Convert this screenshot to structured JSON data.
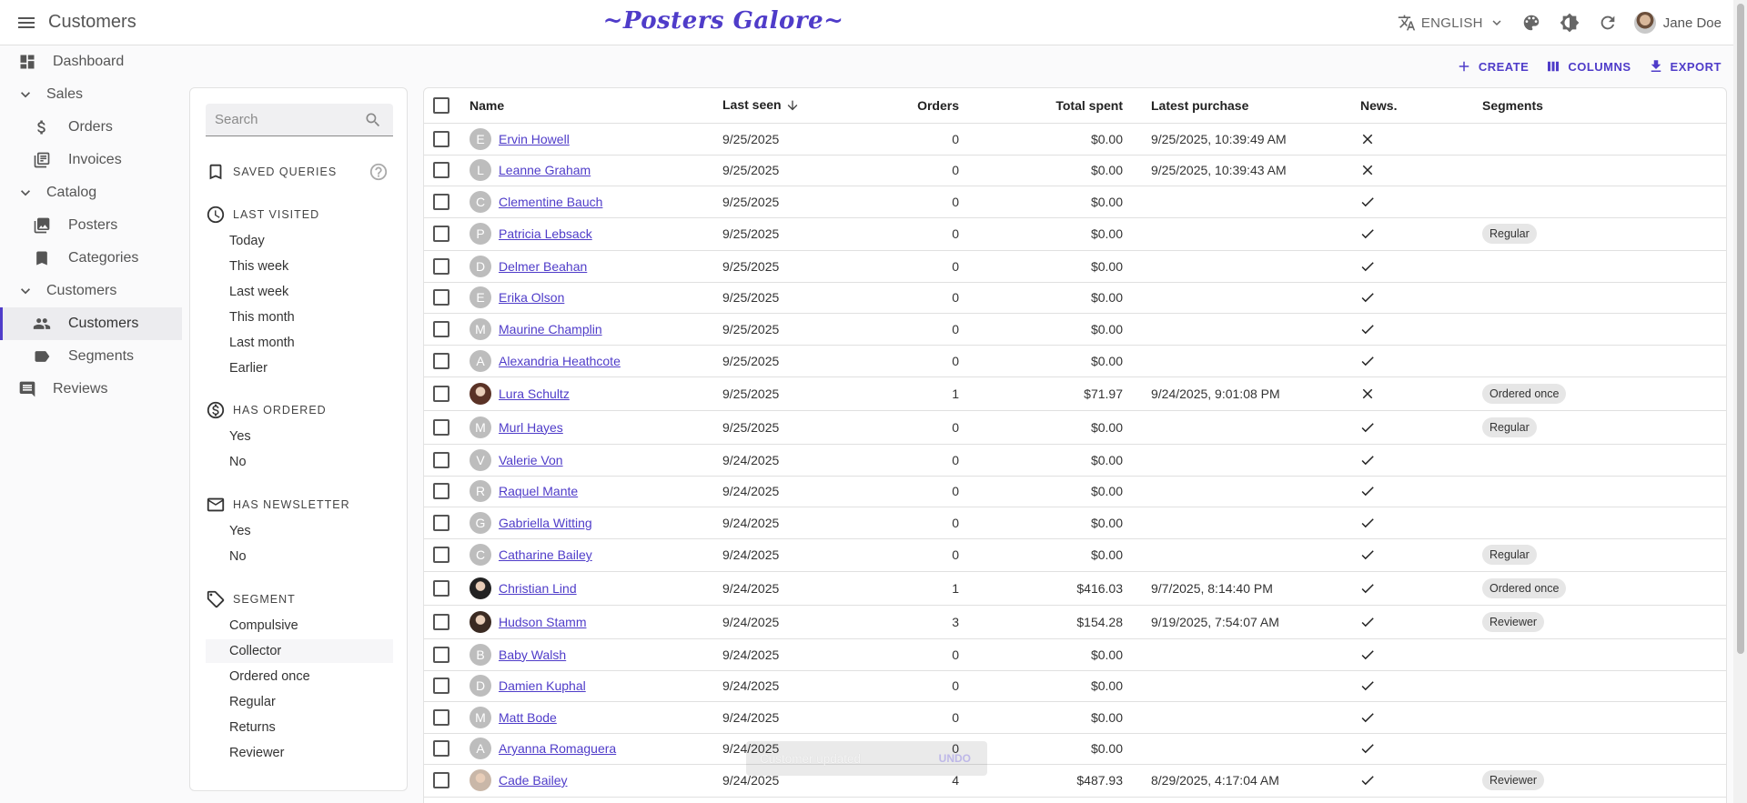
{
  "appbar": {
    "title": "Customers",
    "brand": "~Posters Galore~",
    "language": "ENGLISH",
    "user_name": "Jane Doe"
  },
  "sidebar": {
    "items": [
      {
        "label": "Dashboard",
        "icon": "dashboard-icon",
        "kind": "top"
      },
      {
        "label": "Sales",
        "icon": "chevron-down-icon",
        "kind": "group"
      },
      {
        "label": "Orders",
        "icon": "dollar-icon",
        "kind": "sub"
      },
      {
        "label": "Invoices",
        "icon": "invoice-icon",
        "kind": "sub"
      },
      {
        "label": "Catalog",
        "icon": "chevron-down-icon",
        "kind": "group"
      },
      {
        "label": "Posters",
        "icon": "image-icon",
        "kind": "sub"
      },
      {
        "label": "Categories",
        "icon": "bookmark-icon",
        "kind": "sub"
      },
      {
        "label": "Customers",
        "icon": "chevron-down-icon",
        "kind": "group"
      },
      {
        "label": "Customers",
        "icon": "people-icon",
        "kind": "active"
      },
      {
        "label": "Segments",
        "icon": "label-icon",
        "kind": "sub"
      },
      {
        "label": "Reviews",
        "icon": "comment-icon",
        "kind": "top"
      }
    ]
  },
  "filters": {
    "search_placeholder": "Search",
    "saved_queries": "SAVED QUERIES",
    "last_visited": {
      "label": "LAST VISITED",
      "options": [
        "Today",
        "This week",
        "Last week",
        "This month",
        "Last month",
        "Earlier"
      ]
    },
    "has_ordered": {
      "label": "HAS ORDERED",
      "options": [
        "Yes",
        "No"
      ]
    },
    "has_newsletter": {
      "label": "HAS NEWSLETTER",
      "options": [
        "Yes",
        "No"
      ]
    },
    "segment": {
      "label": "SEGMENT",
      "options": [
        "Compulsive",
        "Collector",
        "Ordered once",
        "Regular",
        "Returns",
        "Reviewer"
      ]
    }
  },
  "actions": {
    "create": "CREATE",
    "columns": "COLUMNS",
    "export": "EXPORT"
  },
  "table": {
    "headers": {
      "name": "Name",
      "last_seen": "Last seen",
      "orders": "Orders",
      "total_spent": "Total spent",
      "latest_purchase": "Latest purchase",
      "newsletter": "News.",
      "segments": "Segments"
    },
    "rows": [
      {
        "initial": "E",
        "photo": "",
        "name": "Ervin Howell",
        "last_seen": "9/25/2025",
        "orders": "0",
        "total": "$0.00",
        "latest": "9/25/2025, 10:39:49 AM",
        "news": false,
        "segment": ""
      },
      {
        "initial": "L",
        "photo": "",
        "name": "Leanne Graham",
        "last_seen": "9/25/2025",
        "orders": "0",
        "total": "$0.00",
        "latest": "9/25/2025, 10:39:43 AM",
        "news": false,
        "segment": ""
      },
      {
        "initial": "C",
        "photo": "",
        "name": "Clementine Bauch",
        "last_seen": "9/25/2025",
        "orders": "0",
        "total": "$0.00",
        "latest": "",
        "news": true,
        "segment": ""
      },
      {
        "initial": "P",
        "photo": "",
        "name": "Patricia Lebsack",
        "last_seen": "9/25/2025",
        "orders": "0",
        "total": "$0.00",
        "latest": "",
        "news": true,
        "segment": "Regular"
      },
      {
        "initial": "D",
        "photo": "",
        "name": "Delmer Beahan",
        "last_seen": "9/25/2025",
        "orders": "0",
        "total": "$0.00",
        "latest": "",
        "news": true,
        "segment": ""
      },
      {
        "initial": "E",
        "photo": "",
        "name": "Erika Olson",
        "last_seen": "9/25/2025",
        "orders": "0",
        "total": "$0.00",
        "latest": "",
        "news": true,
        "segment": ""
      },
      {
        "initial": "M",
        "photo": "",
        "name": "Maurine Champlin",
        "last_seen": "9/25/2025",
        "orders": "0",
        "total": "$0.00",
        "latest": "",
        "news": true,
        "segment": ""
      },
      {
        "initial": "A",
        "photo": "",
        "name": "Alexandria Heathcote",
        "last_seen": "9/25/2025",
        "orders": "0",
        "total": "$0.00",
        "latest": "",
        "news": true,
        "segment": ""
      },
      {
        "initial": "",
        "photo": "#5a3226",
        "name": "Lura Schultz",
        "last_seen": "9/25/2025",
        "orders": "1",
        "total": "$71.97",
        "latest": "9/24/2025, 9:01:08 PM",
        "news": false,
        "segment": "Ordered once"
      },
      {
        "initial": "M",
        "photo": "",
        "name": "Murl Hayes",
        "last_seen": "9/25/2025",
        "orders": "0",
        "total": "$0.00",
        "latest": "",
        "news": true,
        "segment": "Regular"
      },
      {
        "initial": "V",
        "photo": "",
        "name": "Valerie Von",
        "last_seen": "9/24/2025",
        "orders": "0",
        "total": "$0.00",
        "latest": "",
        "news": true,
        "segment": ""
      },
      {
        "initial": "R",
        "photo": "",
        "name": "Raquel Mante",
        "last_seen": "9/24/2025",
        "orders": "0",
        "total": "$0.00",
        "latest": "",
        "news": true,
        "segment": ""
      },
      {
        "initial": "G",
        "photo": "",
        "name": "Gabriella Witting",
        "last_seen": "9/24/2025",
        "orders": "0",
        "total": "$0.00",
        "latest": "",
        "news": true,
        "segment": ""
      },
      {
        "initial": "C",
        "photo": "",
        "name": "Catharine Bailey",
        "last_seen": "9/24/2025",
        "orders": "0",
        "total": "$0.00",
        "latest": "",
        "news": true,
        "segment": "Regular"
      },
      {
        "initial": "",
        "photo": "#222222",
        "name": "Christian Lind",
        "last_seen": "9/24/2025",
        "orders": "1",
        "total": "$416.03",
        "latest": "9/7/2025, 8:14:40 PM",
        "news": true,
        "segment": "Ordered once"
      },
      {
        "initial": "",
        "photo": "#3a2a22",
        "name": "Hudson Stamm",
        "last_seen": "9/24/2025",
        "orders": "3",
        "total": "$154.28",
        "latest": "9/19/2025, 7:54:07 AM",
        "news": true,
        "segment": "Reviewer"
      },
      {
        "initial": "B",
        "photo": "",
        "name": "Baby Walsh",
        "last_seen": "9/24/2025",
        "orders": "0",
        "total": "$0.00",
        "latest": "",
        "news": true,
        "segment": ""
      },
      {
        "initial": "D",
        "photo": "",
        "name": "Damien Kuphal",
        "last_seen": "9/24/2025",
        "orders": "0",
        "total": "$0.00",
        "latest": "",
        "news": true,
        "segment": ""
      },
      {
        "initial": "M",
        "photo": "",
        "name": "Matt Bode",
        "last_seen": "9/24/2025",
        "orders": "0",
        "total": "$0.00",
        "latest": "",
        "news": true,
        "segment": ""
      },
      {
        "initial": "A",
        "photo": "",
        "name": "Aryanna Romaguera",
        "last_seen": "9/24/2025",
        "orders": "0",
        "total": "$0.00",
        "latest": "",
        "news": true,
        "segment": ""
      },
      {
        "initial": "",
        "photo": "#c9b7a8",
        "name": "Cade Bailey",
        "last_seen": "9/24/2025",
        "orders": "4",
        "total": "$487.93",
        "latest": "8/29/2025, 4:17:04 AM",
        "news": true,
        "segment": "Reviewer"
      }
    ]
  },
  "snackbar": {
    "message": "Customer updated",
    "undo": "UNDO"
  },
  "colors": {
    "accent": "#4f3cc9"
  }
}
